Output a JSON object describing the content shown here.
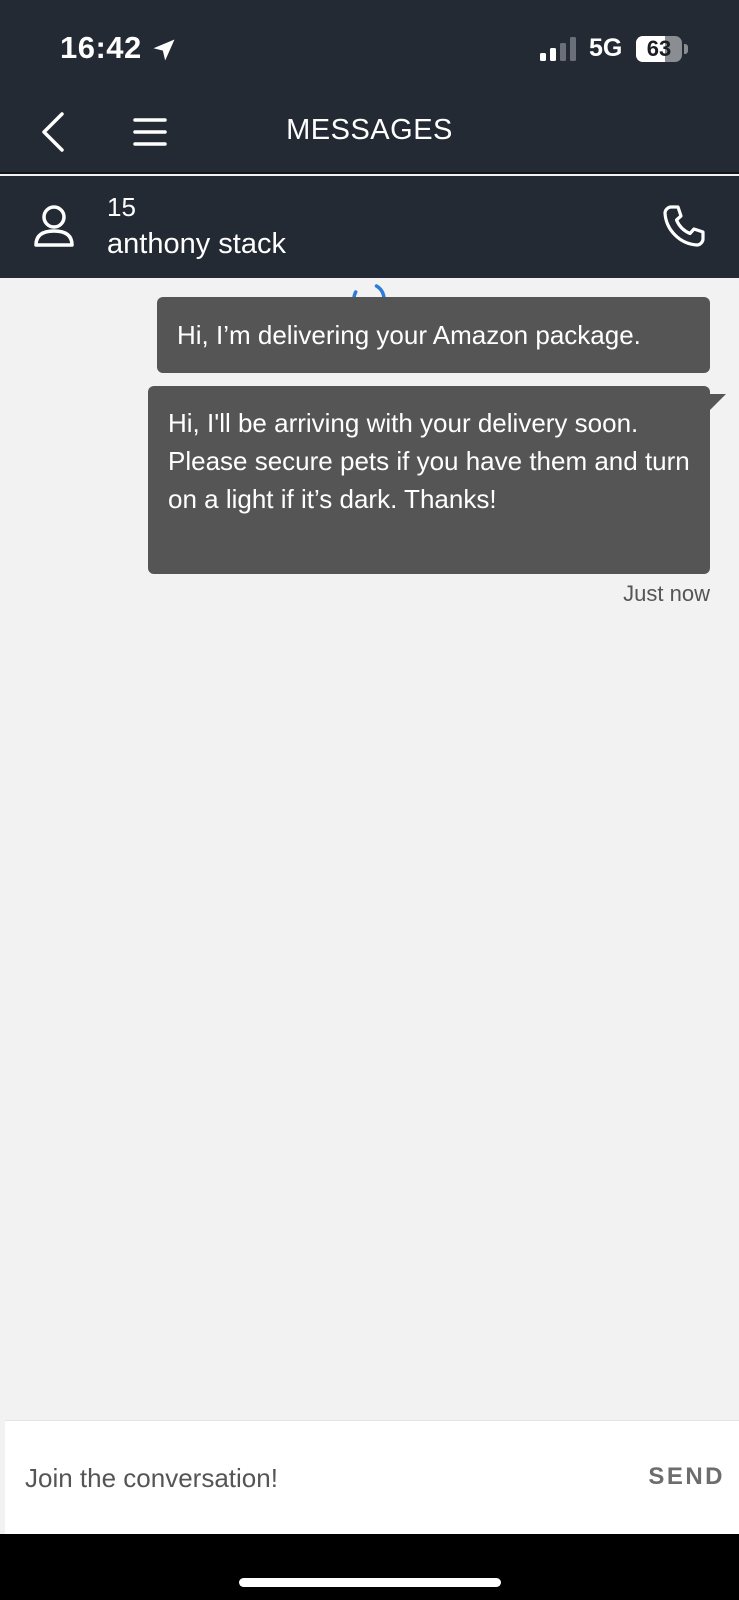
{
  "status_bar": {
    "time": "16:42",
    "network": "5G",
    "battery_percent": "63",
    "battery_level": 0.63,
    "signal_bars_active": 2,
    "signal_bars_total": 4,
    "icons": [
      "location-arrow-icon",
      "signal-icon",
      "battery-icon"
    ]
  },
  "header": {
    "title": "MESSAGES",
    "icons": [
      "chevron-left-icon",
      "hamburger-menu-icon"
    ]
  },
  "contact": {
    "number": "15",
    "name": "anthony stack",
    "icons": [
      "user-icon",
      "phone-icon"
    ]
  },
  "messages": [
    {
      "text": "Hi, I’m delivering your Amazon package."
    },
    {
      "text": "Hi, I'll be arriving with your delivery soon. Please secure pets if you have them and turn on a light if it’s dark. Thanks!"
    }
  ],
  "timestamp": "Just now",
  "composer": {
    "placeholder": "Join the conversation!",
    "send_label": "SEND"
  },
  "colors": {
    "header_bg": "#232a33",
    "bubble_bg": "#555555",
    "page_bg": "#f2f2f2",
    "spinner": "#2f7bd8"
  }
}
